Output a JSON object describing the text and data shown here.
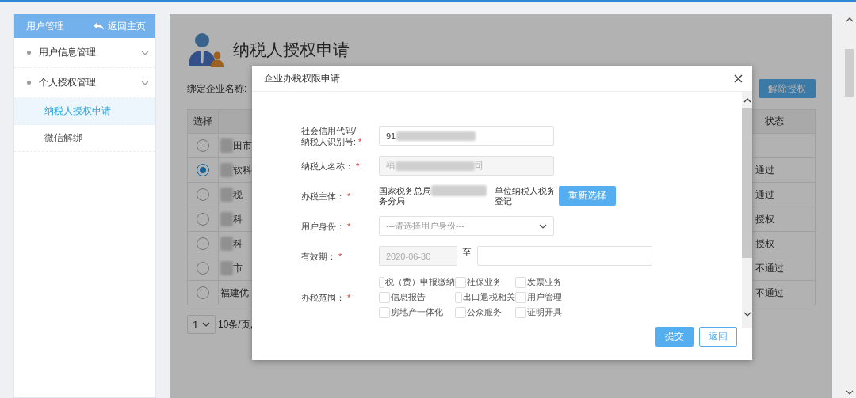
{
  "sidebar": {
    "title": "用户管理",
    "back_link": "返回主页",
    "items": [
      {
        "label": "用户信息管理",
        "selected": false
      },
      {
        "label": "个人授权管理",
        "selected": false,
        "children": [
          {
            "label": "纳税人授权申请",
            "selected": true
          },
          {
            "label": "微信解绑",
            "selected": false
          }
        ]
      }
    ]
  },
  "page": {
    "title": "纳税人授权申请",
    "filter_label": "绑定企业名称:",
    "buttons": [
      "解除授权"
    ],
    "table": {
      "columns": [
        "选择",
        "",
        "状态"
      ],
      "rows": [
        {
          "selected": false,
          "redacted": true,
          "column_2": "田市"
        },
        {
          "selected": true,
          "redacted": true,
          "column_2": "软科",
          "status": "通过"
        },
        {
          "selected": false,
          "redacted": true,
          "column_2": "税",
          "status": "通过"
        },
        {
          "selected": false,
          "redacted": true,
          "column_2": "科",
          "status": "授权"
        },
        {
          "selected": false,
          "redacted": true,
          "column_2": "科",
          "status": "授权"
        },
        {
          "selected": false,
          "redacted": true,
          "column_2": "市",
          "status": "不通过"
        },
        {
          "selected": false,
          "redacted": false,
          "column_2": "福建优",
          "status": "不通过"
        }
      ]
    },
    "pagination": {
      "page": "1",
      "page_size": "10条/页,"
    }
  },
  "dialog": {
    "title": "企业办税权限申请",
    "fields": [
      {
        "kind": "text",
        "label": "社会信用代码/\n纳税人识别号:",
        "required_mark": "*",
        "value": "91",
        "redacted": true
      },
      {
        "kind": "readonly",
        "label": "纳税人名称：",
        "required_mark": "*",
        "value": "福",
        "value_end": "司",
        "redacted": true
      },
      {
        "kind": "office",
        "label": "办税主体：",
        "required_mark": "*",
        "value": "国家税务总局",
        "value_line2": "务分局",
        "note": "单位纳税人税务登记",
        "button": "重新选择"
      },
      {
        "kind": "select",
        "label": "用户身份：",
        "required_mark": "*",
        "placeholder": "---请选择用户身份---"
      },
      {
        "kind": "daterange",
        "label": "有效期：",
        "required_mark": "*",
        "start": "2020-06-30",
        "separator": "至"
      },
      {
        "kind": "checkboxes",
        "label": "办税范围：",
        "required_mark": "*",
        "options": [
          {
            "label": "税（费）申报缴纳",
            "checked": false
          },
          {
            "label": "社保业务",
            "checked": false
          },
          {
            "label": "发票业务",
            "checked": false
          },
          {
            "label": "信息报告",
            "checked": false
          },
          {
            "label": "出口退税相关",
            "checked": false
          },
          {
            "label": "用户管理",
            "checked": false
          },
          {
            "label": "房地产一体化",
            "checked": false
          },
          {
            "label": "公众服务",
            "checked": false
          },
          {
            "label": "证明开具",
            "checked": false
          }
        ]
      }
    ],
    "buttons": [
      {
        "label": "提交",
        "kind": "primary"
      },
      {
        "label": "返回",
        "kind": "secondary"
      }
    ]
  }
}
